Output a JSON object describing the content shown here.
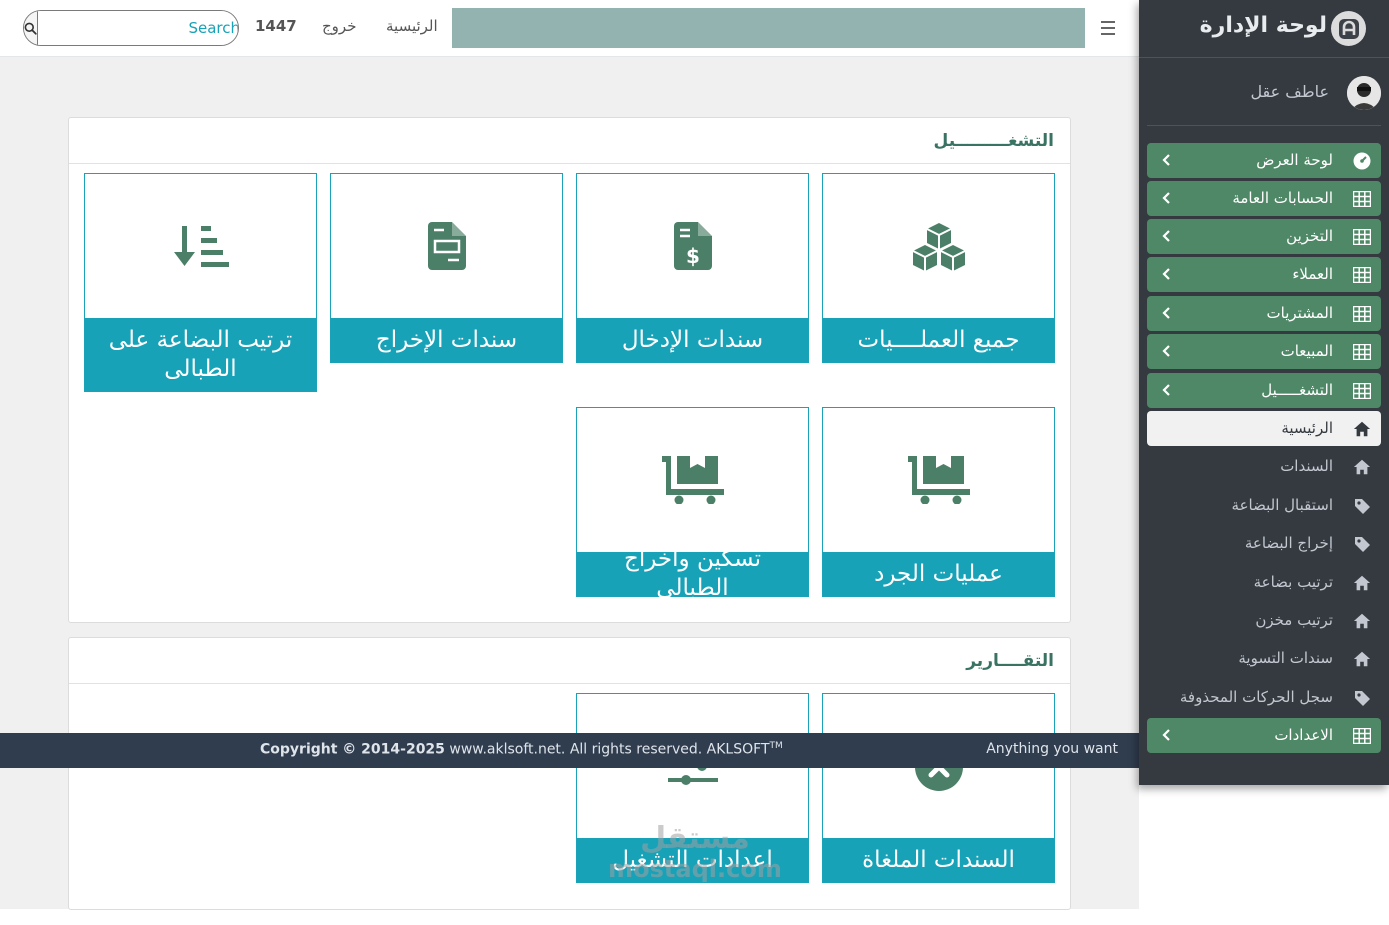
{
  "header": {
    "search_placeholder": "Search",
    "year": "1447",
    "logout_label": "خروج",
    "home_label": "الرئيسية"
  },
  "operations": {
    "title": "التشغـــــــــيل",
    "tiles": [
      {
        "label": "جميع العملــــيات",
        "icon": "cubes-icon"
      },
      {
        "label": "سندات الإدخال",
        "icon": "file-invoice-dollar-icon"
      },
      {
        "label": "سندات الإخراج",
        "icon": "file-invoice-icon"
      },
      {
        "label": "ترتيب البضاعة على الطبالى",
        "icon": "sort-amount-down-icon"
      },
      {
        "label": "عمليات الجرد",
        "icon": "dolly-flatbed-icon"
      },
      {
        "label": "تسكين واخراج الطبالى",
        "icon": "dolly-flatbed-icon"
      }
    ]
  },
  "reports": {
    "title": "التقــــارير",
    "tiles": [
      {
        "label": "السندات الملغاة",
        "icon": "times-circle-icon"
      },
      {
        "label": "اعدادات التشغيل",
        "icon": "sliders-icon"
      }
    ]
  },
  "footer": {
    "copyright_bold": "Copyright © 2014-2025",
    "copyright_rest": " www.aklsoft.net. All rights reserved. AKLSOFT",
    "tm": "TM",
    "right_text": "Anything you want"
  },
  "watermark": {
    "arabic": "مستقل",
    "latin": "mostaql.com"
  },
  "sidebar": {
    "brand": "لوحة الإدارة",
    "user_name": "عاطف عقل",
    "items": [
      {
        "label": "لوحة العرض",
        "icon": "tachometer-icon",
        "style": "green"
      },
      {
        "label": "الحسابات العامة",
        "icon": "table-icon",
        "style": "green"
      },
      {
        "label": "التخزين",
        "icon": "table-icon",
        "style": "green"
      },
      {
        "label": "العملاء",
        "icon": "table-icon",
        "style": "green"
      },
      {
        "label": "المشتريات",
        "icon": "table-icon",
        "style": "green"
      },
      {
        "label": "المبيعات",
        "icon": "table-icon",
        "style": "green"
      },
      {
        "label": "التشغـــــيل",
        "icon": "table-icon",
        "style": "green"
      },
      {
        "label": "الرئيسية",
        "icon": "home-icon",
        "style": "active"
      },
      {
        "label": "السندات",
        "icon": "home-icon",
        "style": "plain"
      },
      {
        "label": "استقبال البضاعة",
        "icon": "tag-icon",
        "style": "plain"
      },
      {
        "label": "إخراج البضاعة",
        "icon": "tag-icon",
        "style": "plain"
      },
      {
        "label": "ترتيب بضاعة",
        "icon": "home-icon",
        "style": "plain"
      },
      {
        "label": "ترتيب مخزن",
        "icon": "home-icon",
        "style": "plain"
      },
      {
        "label": "سندات التسوية",
        "icon": "home-icon",
        "style": "plain"
      },
      {
        "label": "سجل الحركات المحذوفة",
        "icon": "tag-icon",
        "style": "plain"
      },
      {
        "label": "الاعدادات",
        "icon": "table-icon",
        "style": "green"
      }
    ]
  },
  "colors": {
    "tile_label_bg": "#17a2b8",
    "icon_green": "#4b7f68",
    "sidebar_bg": "#343a40",
    "sidebar_green": "#4f8866",
    "footer_bg": "#2f3d4f"
  }
}
